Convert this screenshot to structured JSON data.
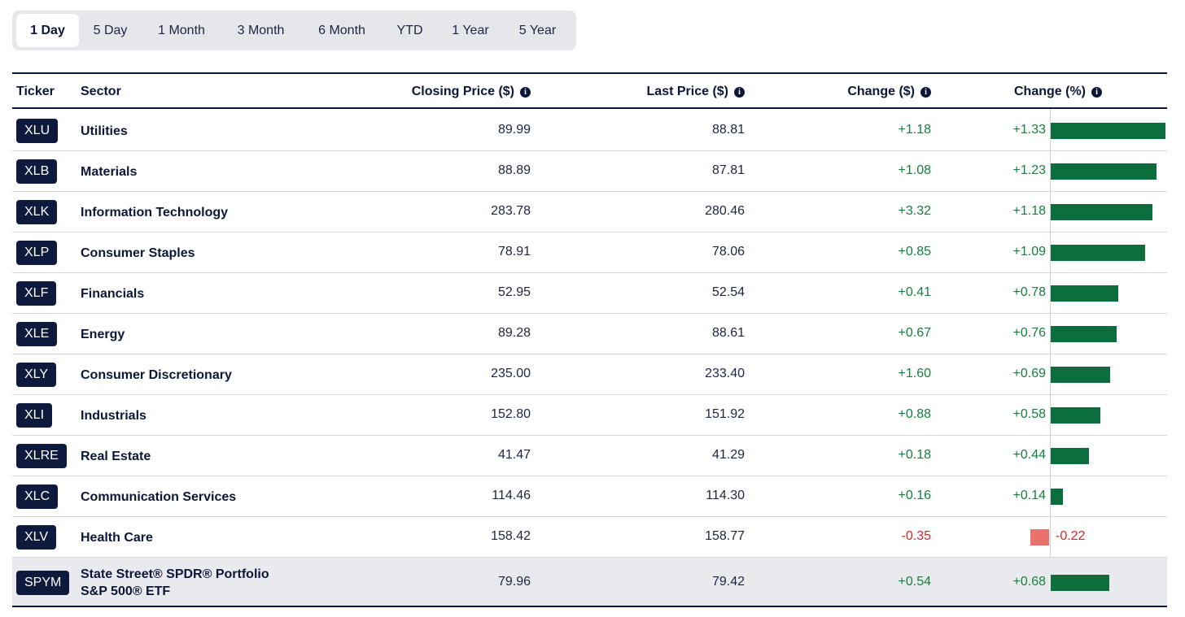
{
  "tabs": [
    "1 Day",
    "5 Day",
    "1 Month",
    "3 Month",
    "6 Month",
    "YTD",
    "1 Year",
    "5 Year"
  ],
  "active_tab": "1 Day",
  "headers": {
    "ticker": "Ticker",
    "sector": "Sector",
    "closing": "Closing Price ($)",
    "last": "Last Price ($)",
    "change": "Change ($)",
    "change_pct": "Change (%)"
  },
  "rows": [
    {
      "ticker": "XLU",
      "sector": "Utilities",
      "closing": "89.99",
      "last": "88.81",
      "change": "+1.18",
      "change_pct": "+1.33",
      "pct_value": 1.33
    },
    {
      "ticker": "XLB",
      "sector": "Materials",
      "closing": "88.89",
      "last": "87.81",
      "change": "+1.08",
      "change_pct": "+1.23",
      "pct_value": 1.23
    },
    {
      "ticker": "XLK",
      "sector": "Information Technology",
      "closing": "283.78",
      "last": "280.46",
      "change": "+3.32",
      "change_pct": "+1.18",
      "pct_value": 1.18
    },
    {
      "ticker": "XLP",
      "sector": "Consumer Staples",
      "closing": "78.91",
      "last": "78.06",
      "change": "+0.85",
      "change_pct": "+1.09",
      "pct_value": 1.09
    },
    {
      "ticker": "XLF",
      "sector": "Financials",
      "closing": "52.95",
      "last": "52.54",
      "change": "+0.41",
      "change_pct": "+0.78",
      "pct_value": 0.78
    },
    {
      "ticker": "XLE",
      "sector": "Energy",
      "closing": "89.28",
      "last": "88.61",
      "change": "+0.67",
      "change_pct": "+0.76",
      "pct_value": 0.76
    },
    {
      "ticker": "XLY",
      "sector": "Consumer Discretionary",
      "closing": "235.00",
      "last": "233.40",
      "change": "+1.60",
      "change_pct": "+0.69",
      "pct_value": 0.69
    },
    {
      "ticker": "XLI",
      "sector": "Industrials",
      "closing": "152.80",
      "last": "151.92",
      "change": "+0.88",
      "change_pct": "+0.58",
      "pct_value": 0.58
    },
    {
      "ticker": "XLRE",
      "sector": "Real Estate",
      "closing": "41.47",
      "last": "41.29",
      "change": "+0.18",
      "change_pct": "+0.44",
      "pct_value": 0.44
    },
    {
      "ticker": "XLC",
      "sector": "Communication Services",
      "closing": "114.46",
      "last": "114.30",
      "change": "+0.16",
      "change_pct": "+0.14",
      "pct_value": 0.14
    },
    {
      "ticker": "XLV",
      "sector": "Health Care",
      "closing": "158.42",
      "last": "158.77",
      "change": "-0.35",
      "change_pct": "-0.22",
      "pct_value": -0.22
    },
    {
      "ticker": "SPYM",
      "sector": "State Street® SPDR® Portfolio S&P 500® ETF",
      "closing": "79.96",
      "last": "79.42",
      "change": "+0.54",
      "change_pct": "+0.68",
      "pct_value": 0.68,
      "highlight": true
    }
  ],
  "colors": {
    "navy": "#0b1638",
    "positive_text": "#15803d",
    "negative_text": "#dc2626",
    "positive_bar": "#0c6e3d",
    "negative_bar": "#ec706b"
  }
}
